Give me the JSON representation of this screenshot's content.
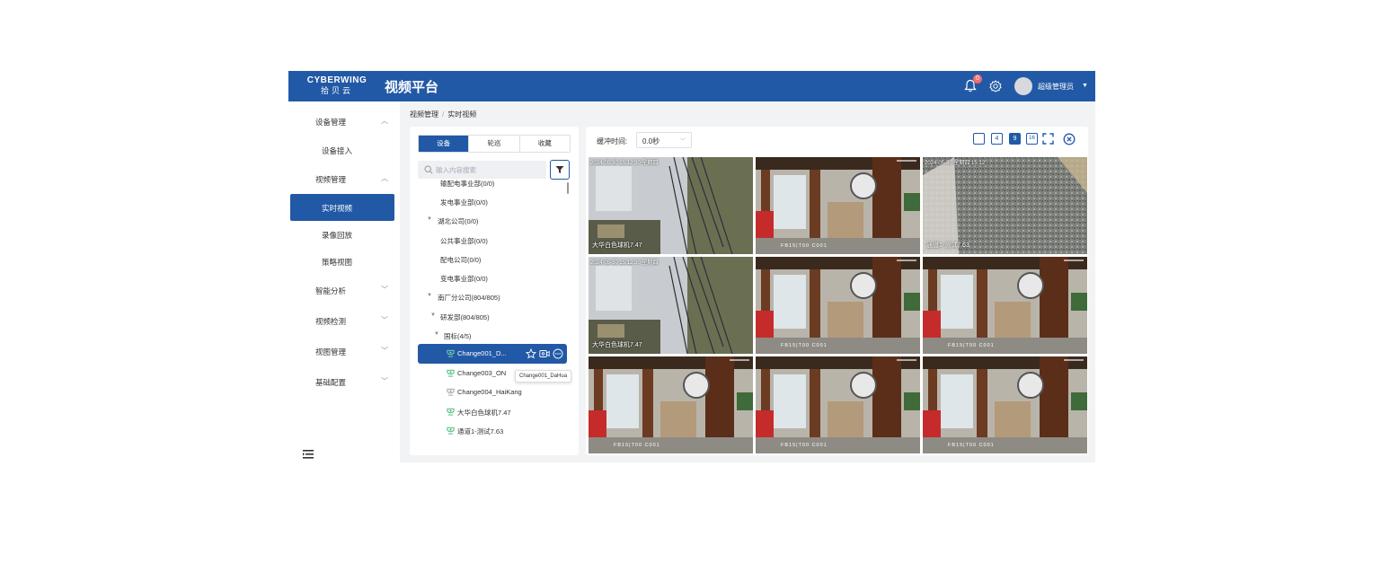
{
  "header": {
    "logo_en": "CYBERWING",
    "logo_cn": "拾贝云",
    "title": "视频平台",
    "notification_count": "0",
    "username": "超级管理员"
  },
  "sidebar": {
    "items": [
      {
        "label": "设备管理",
        "type": "group",
        "state": "expanded"
      },
      {
        "label": "设备接入",
        "type": "sub"
      },
      {
        "label": "视频管理",
        "type": "group",
        "state": "expanded"
      },
      {
        "label": "实时视频",
        "type": "sub",
        "active": true
      },
      {
        "label": "录像回放",
        "type": "sub"
      },
      {
        "label": "策略视图",
        "type": "sub"
      },
      {
        "label": "智能分析",
        "type": "group",
        "state": "collapsed"
      },
      {
        "label": "视频检测",
        "type": "group",
        "state": "collapsed"
      },
      {
        "label": "视图管理",
        "type": "group",
        "state": "collapsed"
      },
      {
        "label": "基础配置",
        "type": "group",
        "state": "collapsed"
      }
    ]
  },
  "breadcrumb": {
    "root": "视频管理",
    "separator": "/",
    "current": "实时视频"
  },
  "left_panel": {
    "tabs": [
      "设备",
      "轮巡",
      "收藏"
    ],
    "active_tab": "设备",
    "search_placeholder": "输入内容搜索",
    "tree": [
      {
        "label": "输配电事业部(0/0)",
        "level": 2
      },
      {
        "label": "发电事业部(0/0)",
        "level": 2
      },
      {
        "label": "湖北公司(0/0)",
        "level": 1,
        "expanded": true
      },
      {
        "label": "公共事业部(0/0)",
        "level": 2
      },
      {
        "label": "配电公司(0/0)",
        "level": 2
      },
      {
        "label": "变电事业部(0/0)",
        "level": 2
      },
      {
        "label": "南厂分公司(804/805)",
        "level": 1,
        "expanded": true
      },
      {
        "label": "研发部(804/805)",
        "level": 2,
        "expanded": true
      },
      {
        "label": "国标(4/5)",
        "level": 3,
        "expanded": true
      },
      {
        "label": "Change001_D...",
        "level": 4,
        "camera": true,
        "online": true,
        "selected": true
      },
      {
        "label": "Change003_ON",
        "level": 4,
        "camera": true,
        "online": true
      },
      {
        "label": "Change004_HaiKang",
        "level": 4,
        "camera": true,
        "online": false
      },
      {
        "label": "大华白色球机7.47",
        "level": 4,
        "camera": true,
        "online": true
      },
      {
        "label": "通道1-测试7.63",
        "level": 4,
        "camera": true,
        "online": true
      }
    ],
    "tooltip": "Change001_DaHua"
  },
  "toolbar": {
    "buffer_label": "缓冲时间:",
    "buffer_value": "0.0秒",
    "layouts": [
      "",
      "4",
      "9",
      "16"
    ],
    "active_layout": "9"
  },
  "video_grid": {
    "cells": [
      {
        "scene": "office",
        "timestamp": "2024-05-30 15:12:30 星期四",
        "caption": "大华白色球机7.47"
      },
      {
        "scene": "room",
        "timestamp": "",
        "caption": "FB15|T00   C001"
      },
      {
        "scene": "noise",
        "timestamp": "2024-05-30 星期四 15:12",
        "caption": "通道1-测试7.63"
      },
      {
        "scene": "office",
        "timestamp": "2024-05-30 15:12:30 星期四",
        "caption": "大华白色球机7.47"
      },
      {
        "scene": "room",
        "timestamp": "",
        "caption": "FB15|T00   C001"
      },
      {
        "scene": "room",
        "timestamp": "",
        "caption": "FB15|T00   C001"
      },
      {
        "scene": "room",
        "timestamp": "",
        "caption": "FB15|T00   C001"
      },
      {
        "scene": "room",
        "timestamp": "",
        "caption": "FB15|T00   C001"
      },
      {
        "scene": "room",
        "timestamp": "",
        "caption": "FB15|T00   C001"
      }
    ]
  },
  "colors": {
    "primary": "#2259a6",
    "badge": "#f56c6c",
    "online": "#3bb66b",
    "offline": "#999999"
  }
}
